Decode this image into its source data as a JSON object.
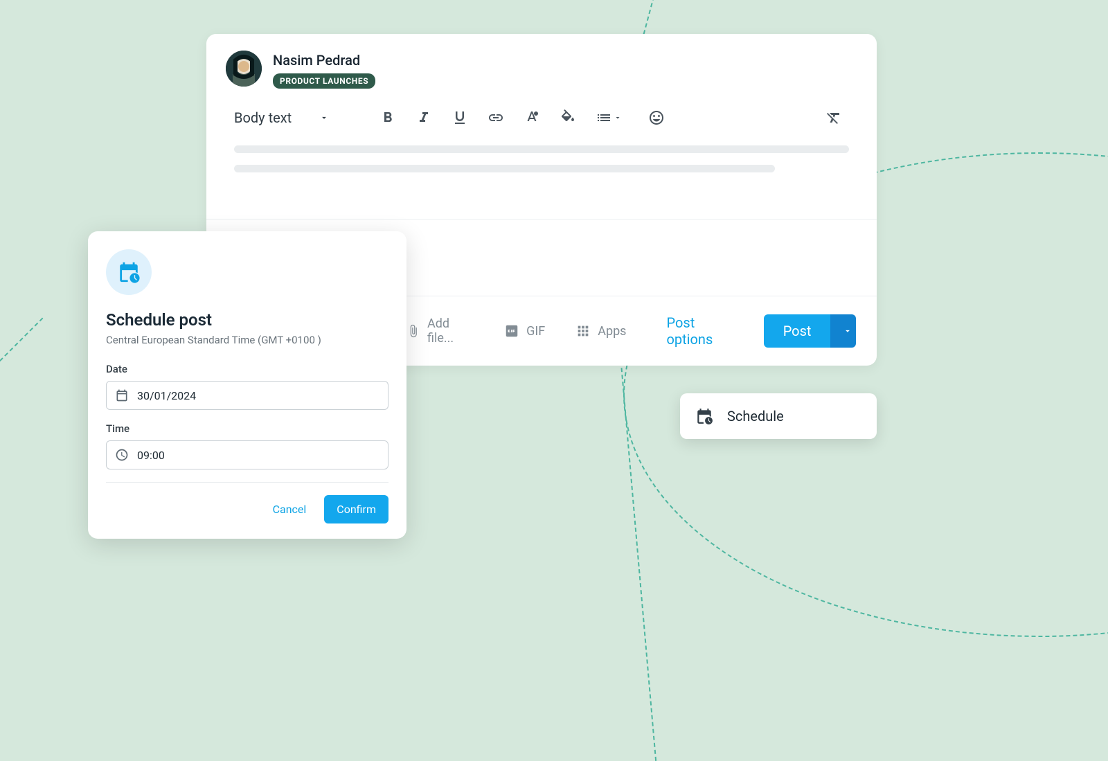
{
  "composer": {
    "user_name": "Nasim Pedrad",
    "tag_label": "PRODUCT LAUNCHES",
    "style_select": "Body text",
    "footer": {
      "add_file": "Add file...",
      "gif": "GIF",
      "apps": "Apps",
      "post_options": "Post options",
      "post": "Post"
    }
  },
  "dropdown": {
    "schedule": "Schedule"
  },
  "modal": {
    "title": "Schedule post",
    "subtitle": "Central European Standard Time (GMT +0100 )",
    "date_label": "Date",
    "date_value": "30/01/2024",
    "time_label": "Time",
    "time_value": "09:00",
    "cancel": "Cancel",
    "confirm": "Confirm"
  }
}
